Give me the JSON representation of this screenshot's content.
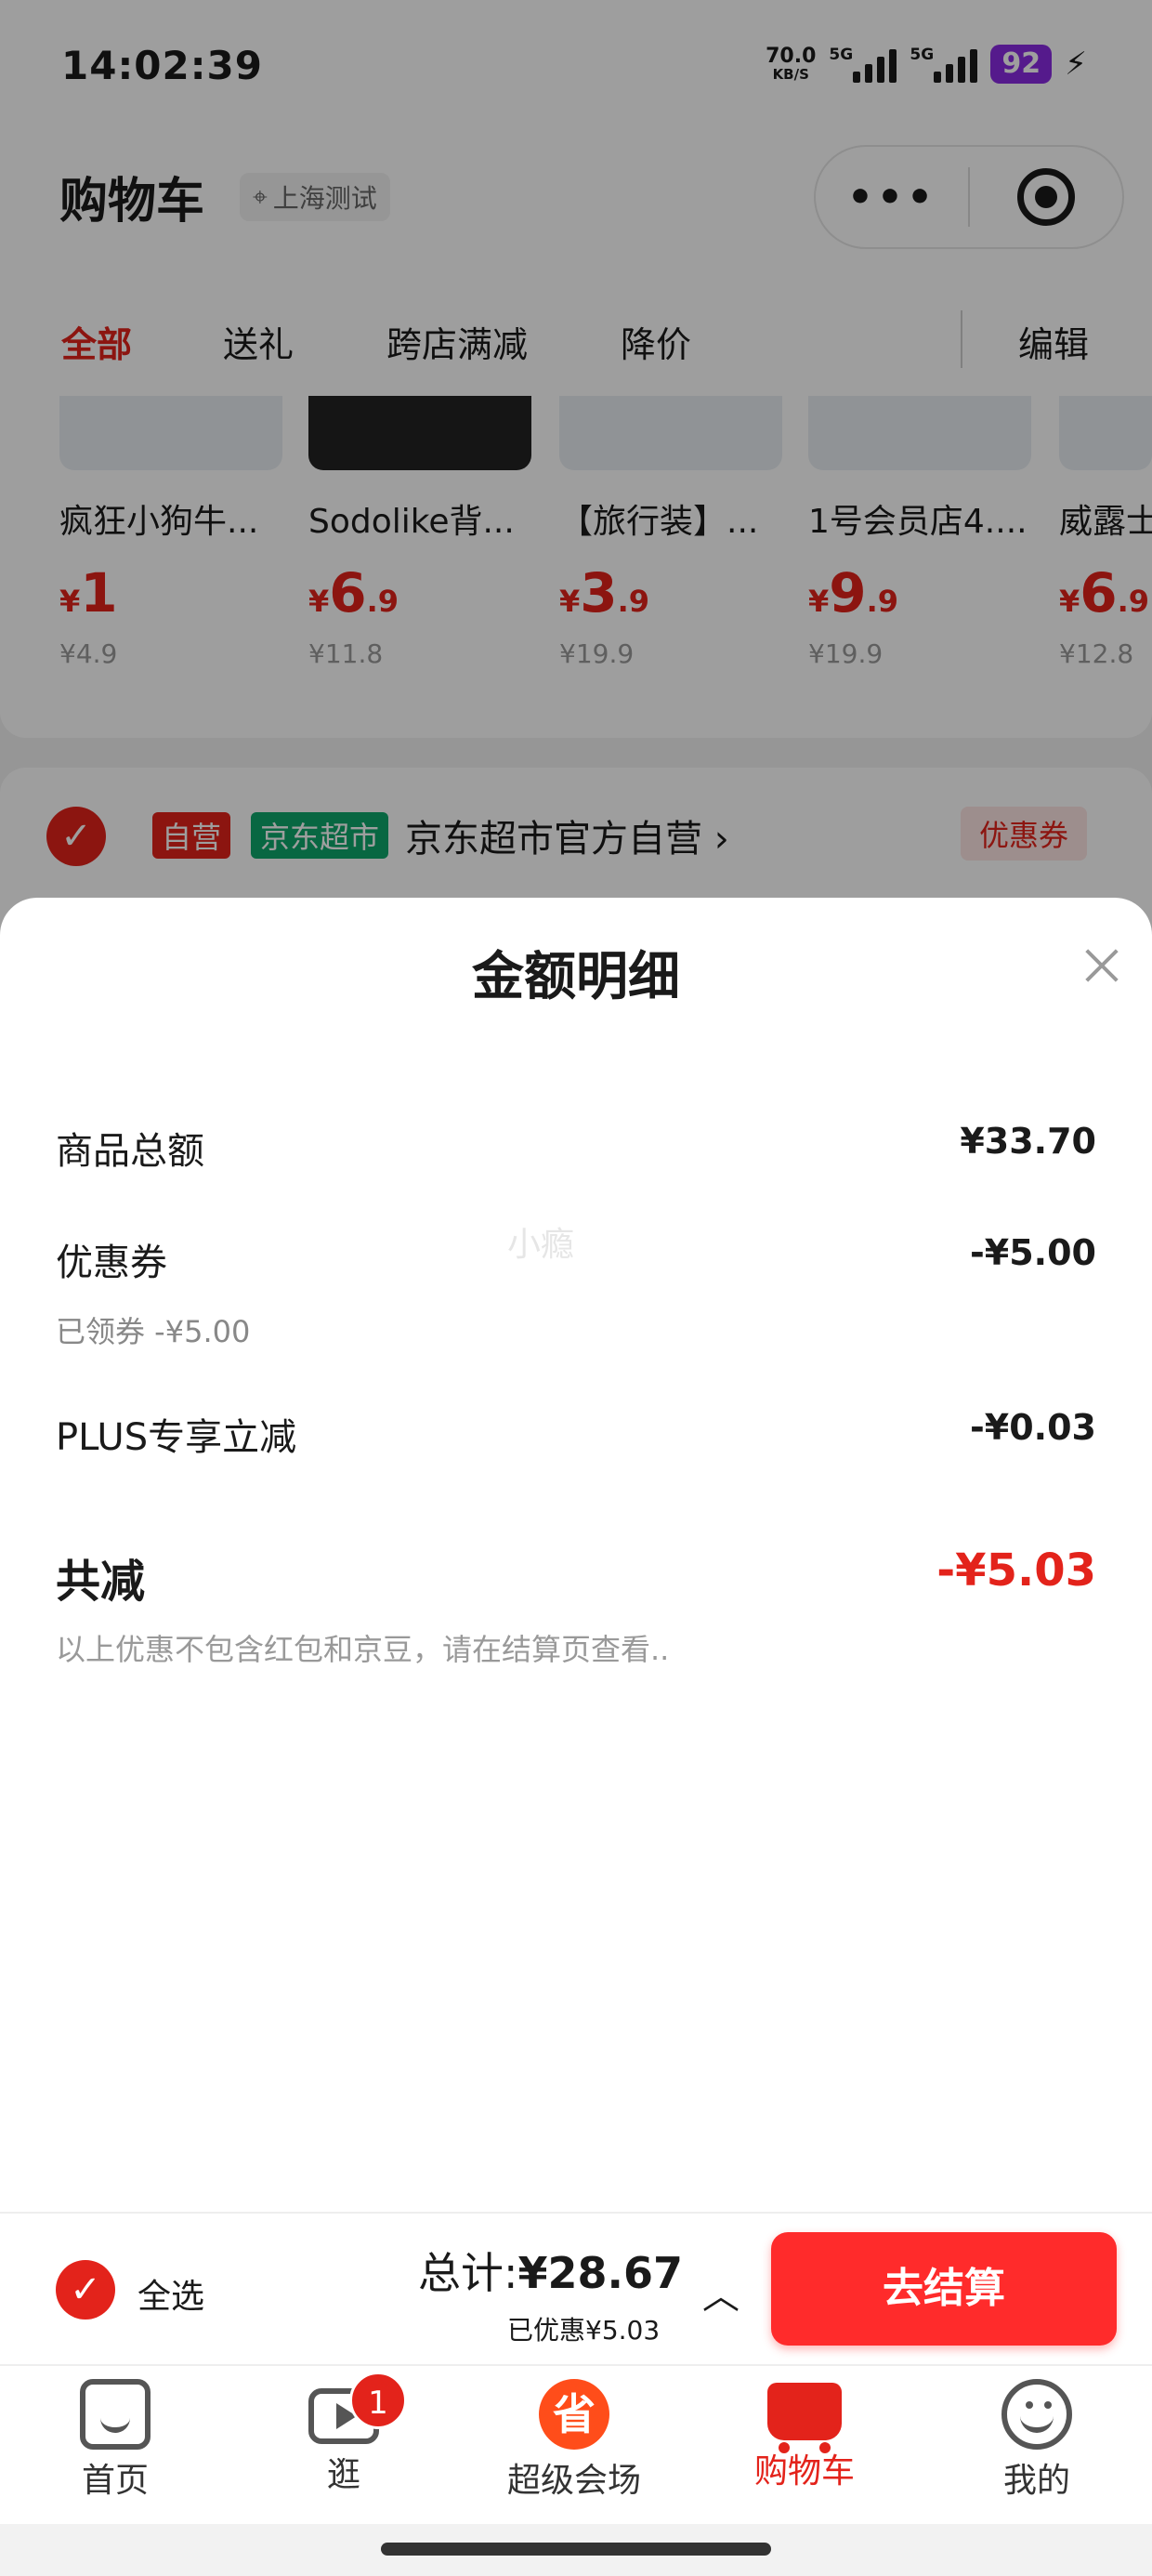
{
  "status_bar": {
    "time": "14:02:39",
    "net_speed": "70.0",
    "net_unit": "KB/S",
    "network1": "5G",
    "network2": "5G",
    "battery": "92",
    "bolt": "⚡"
  },
  "header": {
    "title": "购物车",
    "location": "上海测试",
    "more": "•••"
  },
  "tabs": [
    "全部",
    "送礼",
    "跨店满减",
    "降价",
    "编辑"
  ],
  "products": [
    {
      "name": "疯狂小狗牛...",
      "currency": "¥",
      "price_int": "1",
      "price_dec": "",
      "orig": "¥4.9"
    },
    {
      "name": "Sodolike背...",
      "currency": "¥",
      "price_int": "6",
      "price_dec": ".9",
      "orig": "¥11.8"
    },
    {
      "name": "【旅行装】...",
      "currency": "¥",
      "price_int": "3",
      "price_dec": ".9",
      "orig": "¥19.9"
    },
    {
      "name": "1号会员店4....",
      "currency": "¥",
      "price_int": "9",
      "price_dec": ".9",
      "orig": "¥19.9"
    },
    {
      "name": "威露士",
      "currency": "¥",
      "price_int": "6",
      "price_dec": ".9",
      "orig": "¥12.8"
    }
  ],
  "shop": {
    "badge_self": "自营",
    "badge_market": "京东超市",
    "name": "京东超市官方自营 ›",
    "coupon": "优惠券",
    "check": "✓"
  },
  "sheet": {
    "title": "金额明细",
    "rows": [
      {
        "label": "商品总额",
        "value": "¥33.70"
      },
      {
        "label": "优惠券",
        "value": "-¥5.00",
        "sub": "已领券 -¥5.00"
      },
      {
        "label": "PLUS专享立减",
        "value": "-¥0.03"
      }
    ],
    "watermark": "小瘾",
    "total_label": "共减",
    "total_value": "-¥5.03",
    "note": "以上优惠不包含红包和京豆，请在结算页查看.."
  },
  "checkout": {
    "select_all": "全选",
    "check": "✓",
    "total_label": "总计:",
    "total_value": "¥28.67",
    "saved": "已优惠¥5.03",
    "chevron": "︿",
    "button": "去结算"
  },
  "tabbar": [
    {
      "label": "首页",
      "icon": "home-icon"
    },
    {
      "label": "逛",
      "icon": "play-icon",
      "badge": "1"
    },
    {
      "label": "超级会场",
      "icon": "super-venue-icon",
      "glyph": "省"
    },
    {
      "label": "购物车",
      "icon": "cart-icon",
      "active": true
    },
    {
      "label": "我的",
      "icon": "smile-icon"
    }
  ],
  "colors": {
    "accent": "#e3231b",
    "checkout_button": "#ff2b2b",
    "battery": "#8a2be2",
    "market_badge": "#0ea76b"
  }
}
